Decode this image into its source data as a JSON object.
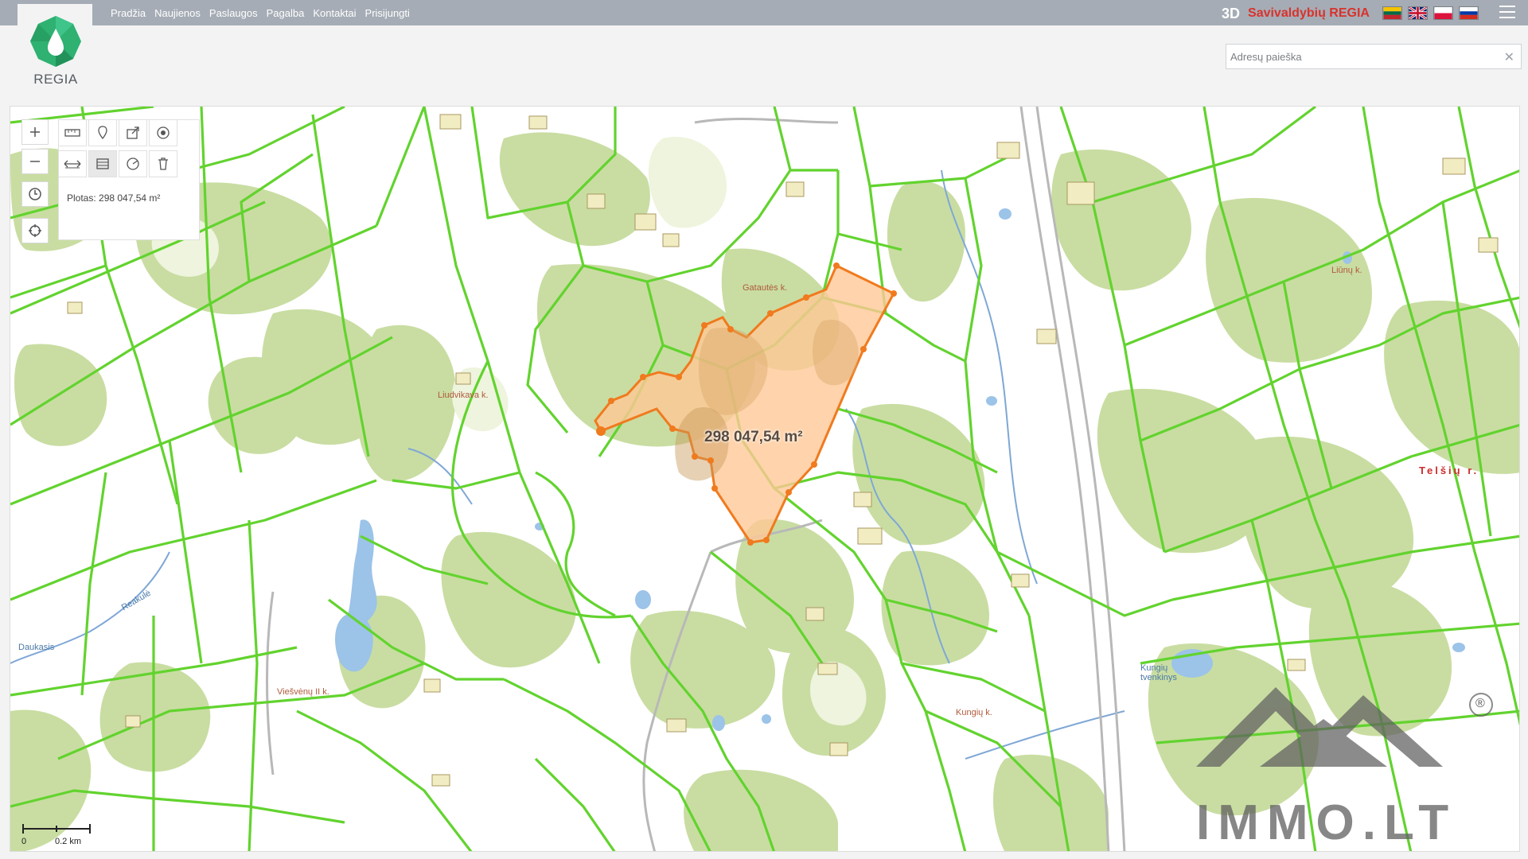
{
  "nav": {
    "items": [
      "Pradžia",
      "Naujienos",
      "Paslaugos",
      "Pagalba",
      "Kontaktai",
      "Prisijungti"
    ]
  },
  "brand": {
    "label_3d": "3D",
    "name": "Savivaldybių REGIA"
  },
  "logo": {
    "text": "REGIA"
  },
  "languages": [
    "lt",
    "en",
    "pl",
    "ru"
  ],
  "search": {
    "placeholder": "Adresų paieška",
    "value": ""
  },
  "map": {
    "measure_readout": "Plotas: 298 047,54 m²",
    "polygon_label": "298 047,54 m²",
    "places": {
      "gataute": "Gatautės k.",
      "liudvikava": "Liudvikava k.",
      "liunu": "Liūnų k.",
      "kungiu": "Kungių k.",
      "viesvenu": "Viešvėnų II k.",
      "kungiu_tvenkinys": "Kungių tvenkinys",
      "daukusis": "Daukasis",
      "reakule": "Reakulė"
    },
    "district": "Telšių r.",
    "scale": {
      "zero": "0",
      "length": "0.2 km"
    }
  },
  "watermark": {
    "text": "IMMO.LT",
    "registered": "®"
  },
  "colors": {
    "topbar": "#a5acb5",
    "parcel_line": "#62d32e",
    "forest": "#c9dda2",
    "selection_fill": "#ffc896",
    "selection_stroke": "#f07a1e",
    "water": "#9cc3e8",
    "brand_red": "#d9322d"
  }
}
